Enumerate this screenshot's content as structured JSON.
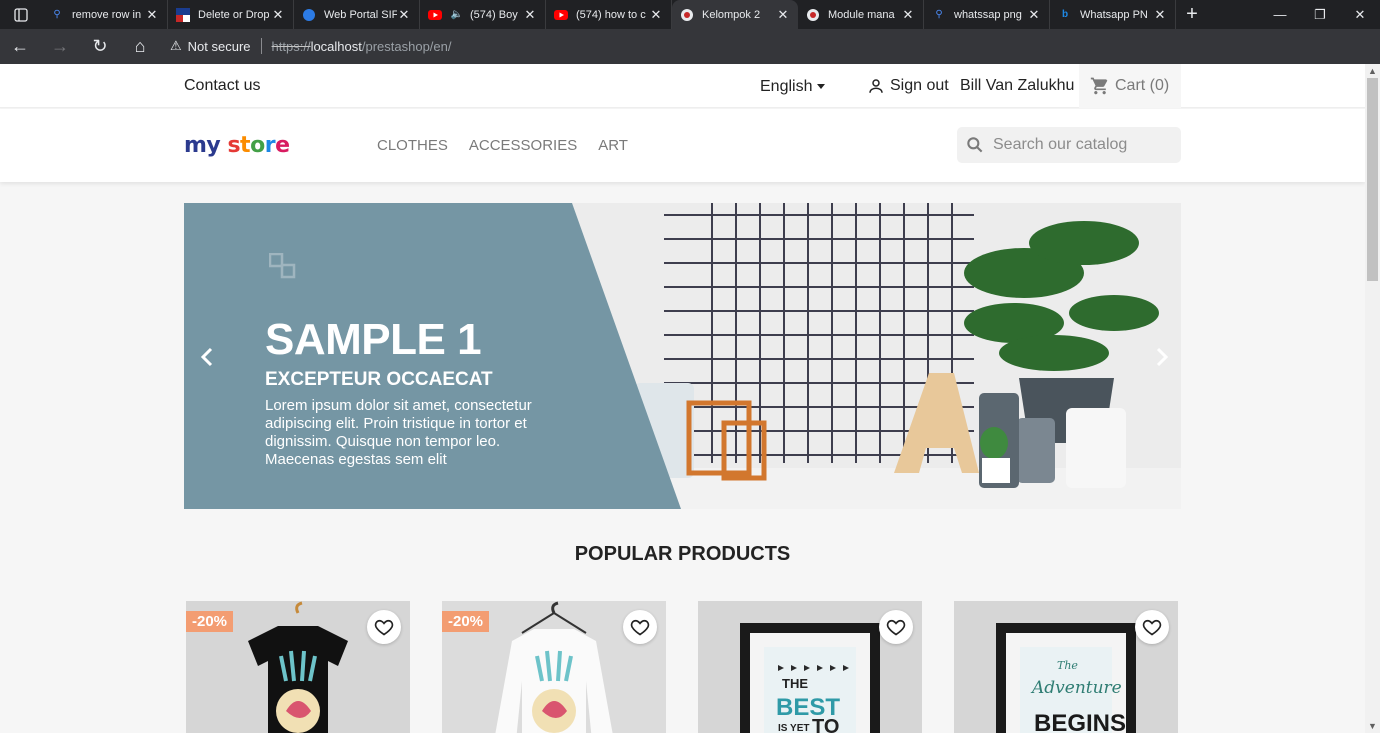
{
  "browser": {
    "tabs": [
      {
        "title": "remove row in",
        "icon": "search-icon"
      },
      {
        "title": "Delete or Drop",
        "icon": "site-icon"
      },
      {
        "title": "Web Portal SIF",
        "icon": "site-icon"
      },
      {
        "title": "(574) Boy",
        "icon": "youtube-icon"
      },
      {
        "title": "(574) how to c",
        "icon": "youtube-icon"
      },
      {
        "title": "Kelompok 2",
        "icon": "site-icon"
      },
      {
        "title": "Module mana",
        "icon": "site-icon"
      },
      {
        "title": "whatssap png",
        "icon": "search-icon"
      },
      {
        "title": "Whatsapp PN",
        "icon": "bing-icon"
      }
    ],
    "active_tab_index": 5,
    "security_label": "Not secure",
    "url_scheme": "https://",
    "url_host": "localhost",
    "url_path": "/prestashop/en/"
  },
  "topnav": {
    "contact": "Contact us",
    "language": "English",
    "signout": "Sign out",
    "username": "Bill Van Zalukhu",
    "cart": "Cart (0)"
  },
  "header": {
    "logo_my": "my",
    "logo_store": "store",
    "menu": [
      "CLOTHES",
      "ACCESSORIES",
      "ART"
    ],
    "search_placeholder": "Search our catalog"
  },
  "slider": {
    "title": "SAMPLE 1",
    "subtitle": "EXCEPTEUR OCCAECAT",
    "text": "Lorem ipsum dolor sit amet, consectetur adipiscing elit. Proin tristique in tortor et dignissim. Quisque non tempor leo. Maecenas egestas sem elit"
  },
  "section": {
    "title": "POPULAR PRODUCTS"
  },
  "products": [
    {
      "discount": "-20%",
      "kind": "black-tshirt"
    },
    {
      "discount": "-20%",
      "kind": "white-sweater"
    },
    {
      "discount": "",
      "kind": "poster-best"
    },
    {
      "discount": "",
      "kind": "poster-adventure"
    }
  ],
  "colors": {
    "slide_panel": "#7596a4",
    "discount": "#f39d72",
    "logo_dark": "#2b3a8e"
  }
}
